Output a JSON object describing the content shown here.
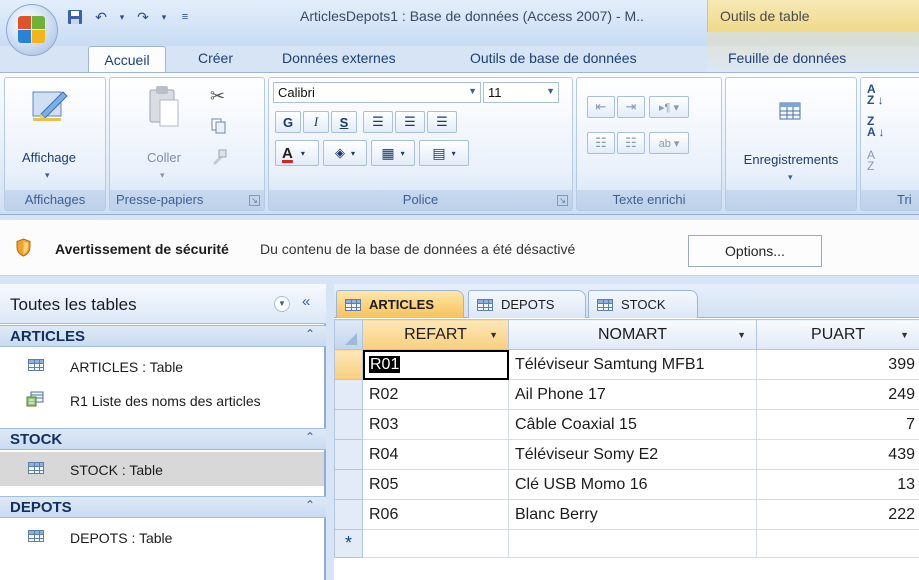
{
  "window": {
    "title": "ArticlesDepots1 : Base de données (Access 2007) - M..",
    "context_tab_group": "Outils de table"
  },
  "ribbon": {
    "tabs": [
      "Accueil",
      "Créer",
      "Données externes",
      "Outils de base de données",
      "Feuille de données"
    ],
    "active_tab": "Accueil",
    "groups": {
      "affichages": {
        "label": "Affichages",
        "button": "Affichage"
      },
      "presse_papiers": {
        "label": "Presse-papiers",
        "button": "Coller"
      },
      "police": {
        "label": "Police",
        "font_name": "Calibri",
        "font_size": "11",
        "bold": "G",
        "italic": "I",
        "underline": "S",
        "font_color": "A"
      },
      "texte_enrichi": {
        "label": "Texte enrichi"
      },
      "enregistrements": {
        "label": "",
        "button": "Enregistrements"
      },
      "trier": {
        "label": "Tri"
      }
    }
  },
  "security_bar": {
    "title": "Avertissement de sécurité",
    "message": "Du contenu de la base de données a été désactivé",
    "options_button": "Options..."
  },
  "nav_pane": {
    "title": "Toutes les tables",
    "groups": [
      {
        "name": "ARTICLES",
        "items": [
          "ARTICLES : Table",
          "R1 Liste des noms des articles"
        ]
      },
      {
        "name": "STOCK",
        "items": [
          "STOCK : Table"
        ]
      },
      {
        "name": "DEPOTS",
        "items": [
          "DEPOTS : Table"
        ]
      }
    ]
  },
  "datasheet": {
    "tabs": [
      "ARTICLES",
      "DEPOTS",
      "STOCK"
    ],
    "active_tab": "ARTICLES",
    "columns": [
      "REFART",
      "NOMART",
      "PUART"
    ],
    "rows": [
      {
        "refart": "R01",
        "nomart": "Téléviseur Samtung MFB1",
        "puart": "399"
      },
      {
        "refart": "R02",
        "nomart": "Ail Phone 17",
        "puart": "249"
      },
      {
        "refart": "R03",
        "nomart": "Câble Coaxial 15",
        "puart": "7"
      },
      {
        "refart": "R04",
        "nomart": "Téléviseur Somy E2",
        "puart": "439"
      },
      {
        "refart": "R05",
        "nomart": "Clé USB Momo 16",
        "puart": "13"
      },
      {
        "refart": "R06",
        "nomart": "Blanc Berry",
        "puart": "222"
      }
    ],
    "new_row_marker": "*"
  },
  "colors": {
    "ribbon_blue": "#d6e4f5",
    "context_yellow": "#efd98a",
    "active_tab_orange": "#f6c259"
  }
}
